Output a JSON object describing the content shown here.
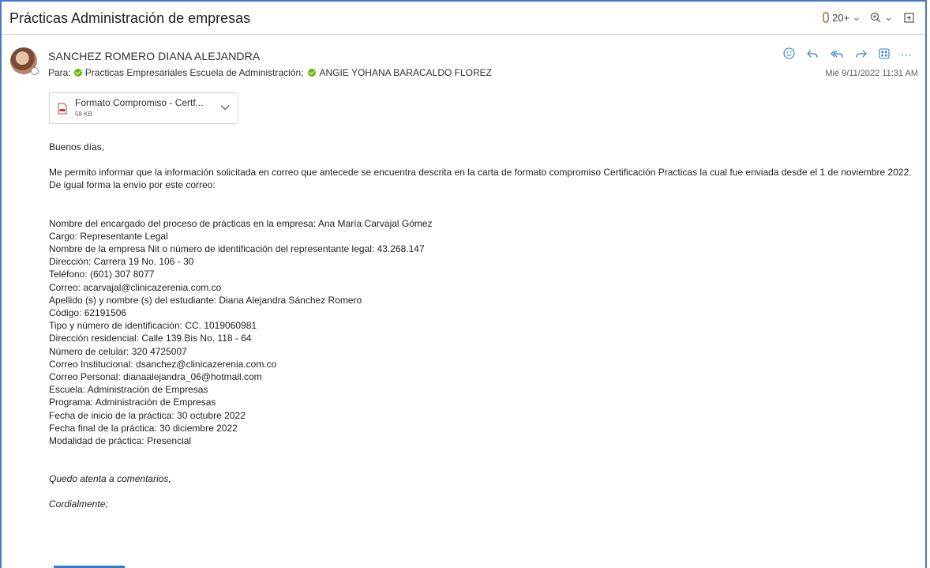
{
  "subject": "Prácticas Administración de empresas",
  "top_tools": {
    "attachment_count": "20+"
  },
  "sender": "SANCHEZ ROMERO DIANA ALEJANDRA",
  "recipients": {
    "label": "Para:",
    "list": [
      "Practicas Empresariales Escuela de Administración;",
      "ANGIE YOHANA BARACALDO FLOREZ"
    ]
  },
  "date": "Mié 9/11/2022 11:31 AM",
  "attachment": {
    "name": "Formato Compromiso - Certf...",
    "size": "58 KB"
  },
  "body": {
    "greeting": "Buenos días,",
    "intro": "Me permito informar que la información solicitada en correo que antecede se encuentra descrita en la carta de formato compromiso Certificación Practicas la cual fue enviada desde el 1 de noviembre 2022. De igual forma la envío por este correo:",
    "details": [
      "Nombre del encargado del proceso de prácticas en la empresa: Ana María Carvajal Gómez",
      "Cargo: Representante Legal",
      "Nombre de la empresa Nit o número de identificación del representante legal: 43.268.147",
      "Dirección: Carrera 19 No. 106 - 30",
      "Teléfono: (601) 307 8077",
      "Correo: acarvajal@clinicazerenia.com.co",
      "Apellido (s) y nombre (s) del estudiante: Diana Alejandra Sánchez Romero",
      "Código: 62191506",
      "Tipo y número de identificación: CC. 1019060981",
      "Dirección residencial: Calle 139 Bis No. 118 - 64",
      "Número de celular: 320 4725007",
      "Correo Institucional: dsanchez@clinicazerenia.com.co",
      "Correo Personal: dianaalejandra_06@hotmail.com",
      "Escuela: Administración de Empresas",
      "Programa: Administración de Empresas",
      "Fecha de inicio de la práctica: 30 octubre 2022",
      "Fecha final de la práctica: 30 diciembre 2022",
      "Modalidad de práctica: Presencial"
    ],
    "closing": "Quedo atenta a comentarios,",
    "signoff": "Cordialmente;"
  }
}
